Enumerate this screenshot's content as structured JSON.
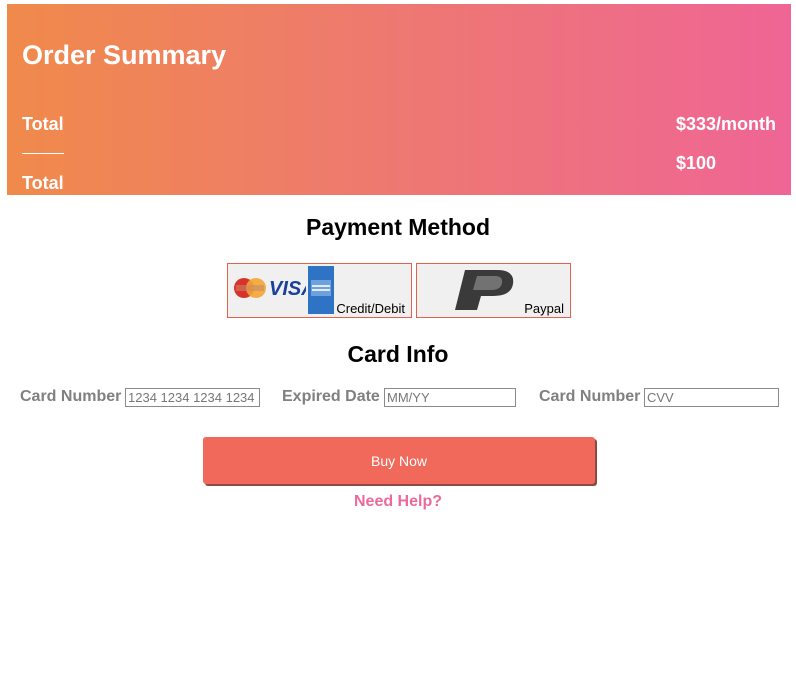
{
  "order_summary": {
    "title": "Order Summary",
    "rows": [
      {
        "label": "Total",
        "value": "$333/month"
      },
      {
        "label": "Total",
        "value": "$100"
      }
    ]
  },
  "payment": {
    "title": "Payment Method",
    "methods": [
      {
        "label": "Credit/Debit",
        "logos": [
          "mastercard-icon",
          "visa-icon",
          "amex-icon"
        ]
      },
      {
        "label": "Paypal",
        "logos": [
          "paypal-icon"
        ]
      }
    ]
  },
  "card_info": {
    "title": "Card Info",
    "fields": [
      {
        "label": "Card Number",
        "placeholder": "1234 1234 1234 1234"
      },
      {
        "label": "Expired Date",
        "placeholder": "MM/YY"
      },
      {
        "label": "Card Number",
        "placeholder": "CVV"
      }
    ]
  },
  "actions": {
    "buy_label": "Buy Now",
    "help_label": "Need Help?"
  },
  "colors": {
    "gradient_start": "#f08a4b",
    "gradient_end": "#ef6595",
    "button": "#f0695a",
    "help_link": "#ec6a9b",
    "method_border": "#e2624d"
  }
}
